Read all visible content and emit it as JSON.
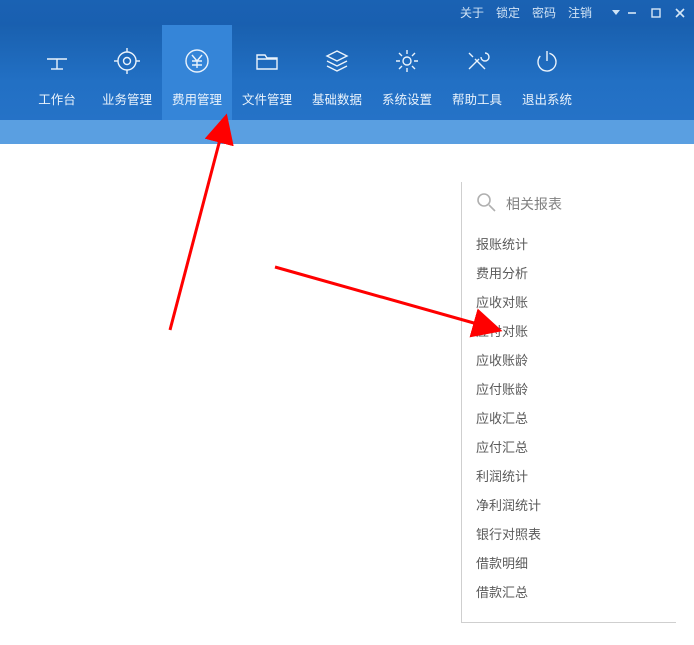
{
  "titlebar": {
    "links": {
      "about": "关于",
      "lock": "锁定",
      "password": "密码",
      "logout": "注销"
    }
  },
  "nav": {
    "items": [
      {
        "label": "工作台"
      },
      {
        "label": "业务管理"
      },
      {
        "label": "费用管理"
      },
      {
        "label": "文件管理"
      },
      {
        "label": "基础数据"
      },
      {
        "label": "系统设置"
      },
      {
        "label": "帮助工具"
      },
      {
        "label": "退出系统"
      }
    ],
    "active_index": 2
  },
  "panel": {
    "title": "相关报表",
    "items": [
      "报账统计",
      "费用分析",
      "应收对账",
      "应付对账",
      "应收账龄",
      "应付账龄",
      "应收汇总",
      "应付汇总",
      "利润统计",
      "净利润统计",
      "银行对照表",
      "借款明细",
      "借款汇总"
    ]
  }
}
